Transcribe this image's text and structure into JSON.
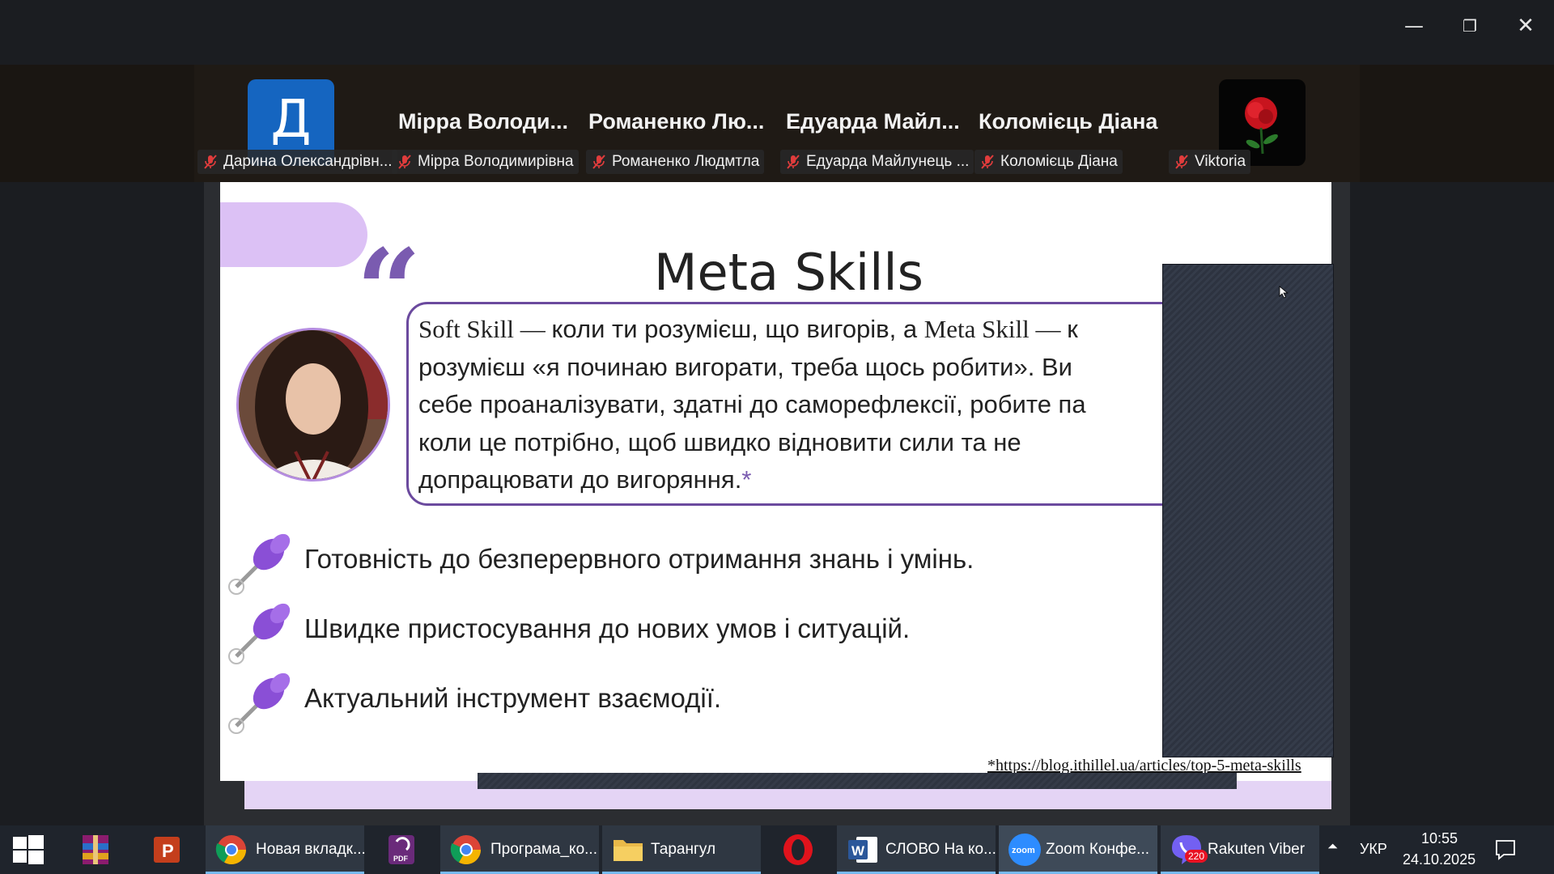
{
  "window": {
    "minimize_glyph": "—",
    "maximize_glyph": "❐",
    "close_glyph": "✕"
  },
  "participants": {
    "avatar_letter": "Д",
    "big_names": [
      "Мірра  Володи...",
      "Романенко  Лю...",
      "Едуарда  Майл...",
      "Коломієць Діана"
    ],
    "labels": [
      "Дарина Олександрівн...",
      "Мірра Володимирівна",
      "Романенко Людмтла",
      "Едуарда Майлунець ...",
      "Коломієць Діана",
      "Viktoria"
    ],
    "muted_icon": "mic-muted-icon"
  },
  "slide": {
    "title": "Meta Skills",
    "quote_lines": [
      {
        "serif": "Soft Skill — ",
        "sans": "коли ти розумієш, що вигорів, а ",
        "serif2": "Meta Skill — ",
        "sans2": "к"
      },
      {
        "sans": "розумієш «я починаю вигорати, треба щось робити». Ви"
      },
      {
        "sans": "себе проаналізувати, здатні до саморефлексії, робите па"
      },
      {
        "sans": "коли це потрібно, щоб швидко відновити сили та не"
      },
      {
        "sans": "допрацювати до вигоряння.",
        "asterisk": "*"
      }
    ],
    "bullets": [
      "Готовність до безперервного отримання знань і умінь.",
      "Швидке пристосування до нових умов і ситуацій.",
      "Актуальний інструмент взаємодії."
    ],
    "footnote": "*https://blog.ithillel.ua/articles/top-5-meta-skills",
    "accent_color": "#7a5bb0",
    "light_accent": "#dcc1f5"
  },
  "taskbar": {
    "apps": [
      {
        "icon": "winrar-icon",
        "label": ""
      },
      {
        "icon": "powerpoint-icon",
        "label": ""
      },
      {
        "icon": "chrome-icon",
        "label": "Новая вкладк..."
      },
      {
        "icon": "pdf-icon",
        "label": ""
      },
      {
        "icon": "chrome-icon",
        "label": "Програма_ко..."
      },
      {
        "icon": "folder-icon",
        "label": "Тарангул"
      },
      {
        "icon": "opera-icon",
        "label": ""
      },
      {
        "icon": "word-icon",
        "label": "СЛОВО На ко..."
      },
      {
        "icon": "zoom-icon",
        "label": "Zoom Конфе..."
      },
      {
        "icon": "viber-icon",
        "label": "Rakuten Viber",
        "badge": "220"
      }
    ],
    "tray": {
      "chevron": "⏶",
      "language": "УКР",
      "time": "10:55",
      "date": "24.10.2025"
    }
  }
}
